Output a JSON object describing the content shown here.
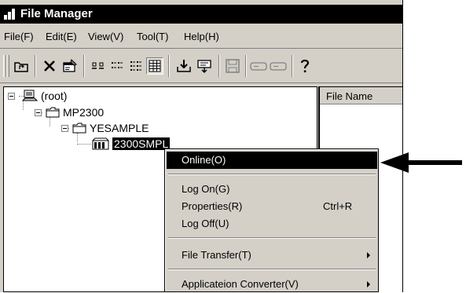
{
  "window": {
    "title": "File Manager"
  },
  "menubar": {
    "items": [
      {
        "label": "File(F)"
      },
      {
        "label": "Edit(E)"
      },
      {
        "label": "View(V)"
      },
      {
        "label": "Tool(T)"
      },
      {
        "label": "Help(H)"
      }
    ]
  },
  "toolbar": {
    "buttons": [
      {
        "icon": "up-folder-icon"
      },
      {
        "icon": "delete-icon"
      },
      {
        "icon": "properties-icon"
      },
      {
        "icon": "large-icons-view-icon"
      },
      {
        "icon": "small-icons-view-icon"
      },
      {
        "icon": "list-view-icon"
      },
      {
        "icon": "details-view-icon",
        "state": "pressed"
      },
      {
        "icon": "transfer-in-icon"
      },
      {
        "icon": "transfer-out-icon"
      },
      {
        "icon": "save-icon"
      },
      {
        "icon": "disabled-tool-1-icon"
      },
      {
        "icon": "disabled-tool-2-icon"
      },
      {
        "icon": "help-icon"
      }
    ]
  },
  "tree": {
    "root": {
      "label": "(root)"
    },
    "nodes": [
      {
        "label": "MP2300"
      },
      {
        "label": "YESAMPLE"
      },
      {
        "label": "2300SMPL",
        "selected": true
      }
    ]
  },
  "list": {
    "column_header": "File Name"
  },
  "context_menu": {
    "items": [
      {
        "label": "Online(O)",
        "shortcut": "",
        "highlighted": true
      },
      {
        "label": "Log On(G)",
        "shortcut": ""
      },
      {
        "label": "Properties(R)",
        "shortcut": "Ctrl+R"
      },
      {
        "label": "Log Off(U)",
        "shortcut": ""
      },
      {
        "label": "File Transfer(T)",
        "shortcut": "",
        "submenu": true
      },
      {
        "label": "Applicateion Converter(V)",
        "shortcut": "",
        "submenu": true
      }
    ]
  },
  "colors": {
    "highlight": "#000000",
    "face": "#d4d0c8",
    "window": "#ffffff"
  }
}
